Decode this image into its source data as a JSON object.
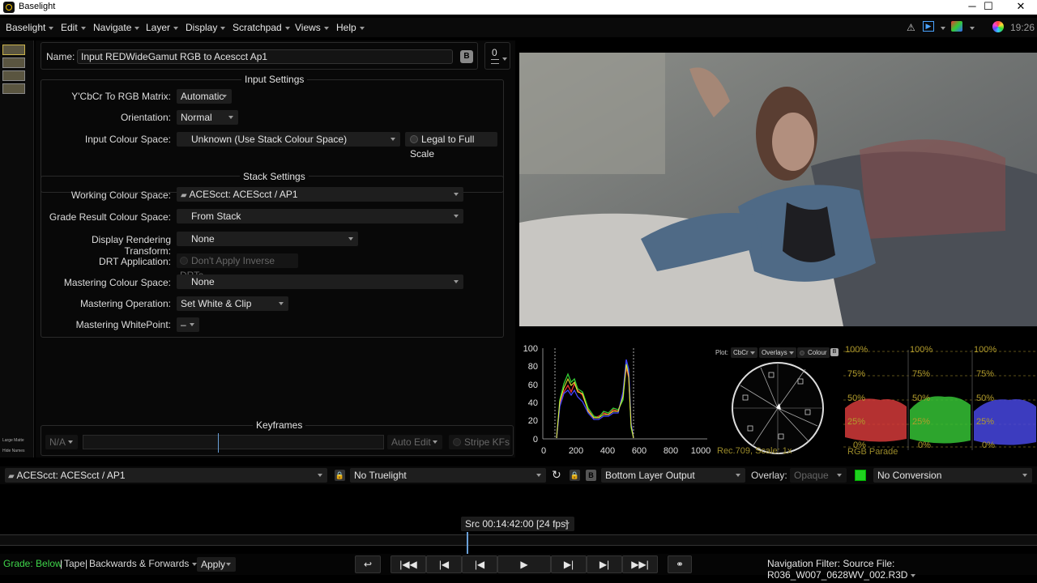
{
  "window": {
    "title": "Baselight",
    "minimize": "─",
    "maximize": "☐",
    "close": "✕"
  },
  "menu": [
    "Baselight",
    "Edit",
    "Navigate",
    "Layer",
    "Display",
    "Scratchpad",
    "Views",
    "Help"
  ],
  "menubar_right": {
    "clock": "19:26"
  },
  "thumbnails": {
    "large_matte": "Large Matte",
    "hide_names": "Hide Names"
  },
  "name_row": {
    "label": "Name:",
    "value": "Input REDWideGamut RGB to Acescct Ap1",
    "counter": "0"
  },
  "input_settings": {
    "title": "Input Settings",
    "ycbcr_label": "Y'CbCr To RGB Matrix:",
    "ycbcr_value": "Automatic",
    "orientation_label": "Orientation:",
    "orientation_value": "Normal",
    "colour_space_label": "Input Colour Space:",
    "colour_space_value": "Unknown (Use Stack Colour Space)",
    "legal_label": "Legal to Full Scale"
  },
  "stack_settings": {
    "title": "Stack Settings",
    "working_label": "Working Colour Space:",
    "working_value": "ACEScct: ACEScct / AP1",
    "grade_label": "Grade Result Colour Space:",
    "grade_value": "From Stack",
    "drt_label": "Display Rendering Transform:",
    "drt_value": "None",
    "drt_app_label": "DRT Application:",
    "drt_app_value": "Don't Apply Inverse DRTs",
    "mastering_label": "Mastering Colour Space:",
    "mastering_value": "None",
    "mop_label": "Mastering Operation:",
    "mop_value": "Set White & Clip",
    "mwp_label": "Mastering WhitePoint:",
    "mwp_value": "–"
  },
  "keyframes": {
    "title": "Keyframes",
    "na": "N/A",
    "auto_edit": "Auto Edit",
    "stripe": "Stripe KFs"
  },
  "histogram": {
    "y_ticks": [
      "100",
      "80",
      "60",
      "40",
      "20",
      "0"
    ],
    "x_ticks": [
      "0",
      "200",
      "400",
      "600",
      "800",
      "1000"
    ]
  },
  "vectorscope": {
    "plot_label": "Plot:",
    "plot_value": "CbCr",
    "overlays": "Overlays",
    "colour": "Colour",
    "footer": "Rec.709, Scale: 1x"
  },
  "parade": {
    "pct100": "100%",
    "pct75": "75%",
    "pct50": "50%",
    "pct25": "25%",
    "pct0": "0%",
    "footer": "RGB Parade"
  },
  "bottom": {
    "colour_space": "ACEScct: ACEScct / AP1",
    "truelight": "No Truelight",
    "layer_output": "Bottom Layer Output",
    "overlay_label": "Overlay:",
    "overlay_value": "Opaque",
    "conversion": "No Conversion"
  },
  "timecode": "Src 00:14:42:00 [24 fps]",
  "transport": {
    "grade_label": "Grade:",
    "grade_value": "Below",
    "tape": "Tape",
    "direction": "Backwards & Forwards",
    "apply": "Apply",
    "nav_filter": "Navigation Filter: Source File: R036_W007_0628WV_002.R3D"
  }
}
